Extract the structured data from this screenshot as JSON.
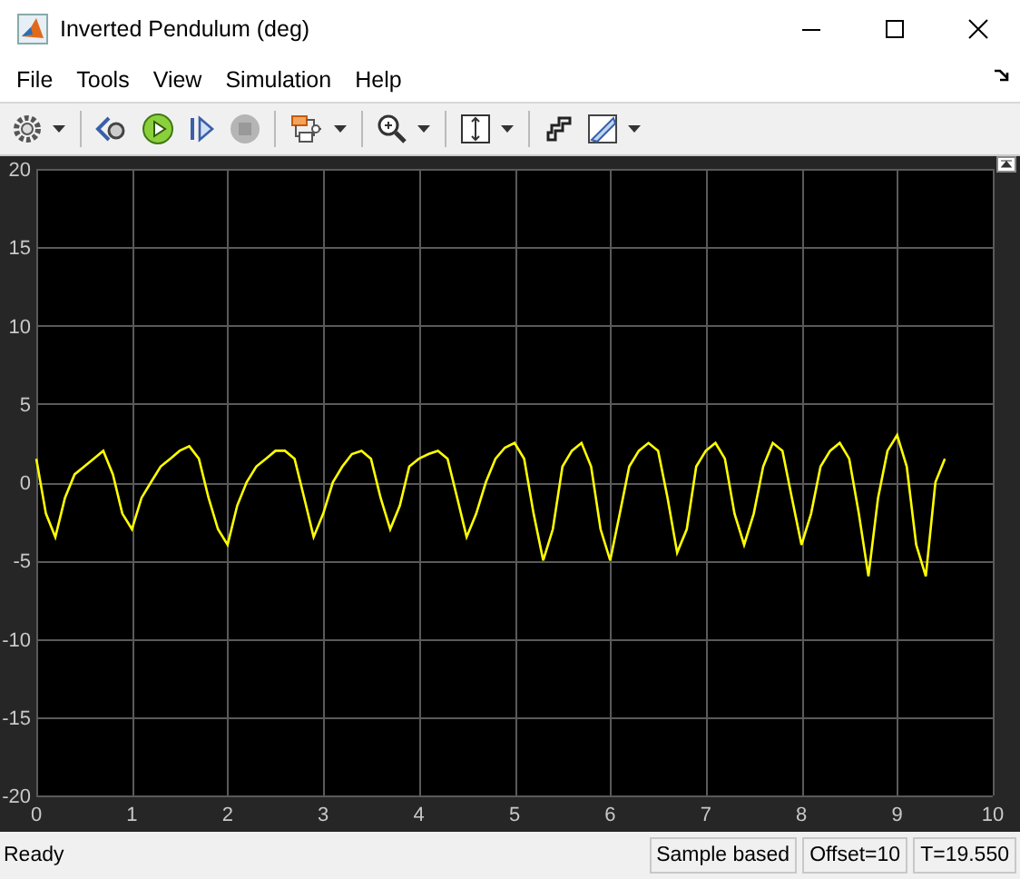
{
  "window": {
    "title": "Inverted Pendulum (deg)"
  },
  "menu": [
    "File",
    "Tools",
    "View",
    "Simulation",
    "Help"
  ],
  "scope": {
    "chart_data": {
      "type": "line",
      "grid": true,
      "xlim": [
        0,
        10
      ],
      "ylim": [
        -20,
        20
      ],
      "xticks": [
        0,
        1,
        2,
        3,
        4,
        5,
        6,
        7,
        8,
        9,
        10
      ],
      "yticks": [
        -20,
        -15,
        -10,
        -5,
        0,
        5,
        10,
        15,
        20
      ],
      "x": [
        0,
        0.1,
        0.2,
        0.3,
        0.4,
        0.5,
        0.6,
        0.7,
        0.8,
        0.9,
        1,
        1.1,
        1.2,
        1.3,
        1.4,
        1.5,
        1.6,
        1.7,
        1.8,
        1.9,
        2,
        2.1,
        2.2,
        2.3,
        2.4,
        2.5,
        2.6,
        2.7,
        2.8,
        2.9,
        3,
        3.1,
        3.2,
        3.3,
        3.4,
        3.5,
        3.6,
        3.7,
        3.8,
        3.9,
        4,
        4.1,
        4.2,
        4.3,
        4.4,
        4.5,
        4.6,
        4.7,
        4.8,
        4.9,
        5,
        5.1,
        5.2,
        5.3,
        5.4,
        5.5,
        5.6,
        5.7,
        5.8,
        5.9,
        6,
        6.1,
        6.2,
        6.3,
        6.4,
        6.5,
        6.6,
        6.7,
        6.8,
        6.9,
        7,
        7.1,
        7.2,
        7.3,
        7.4,
        7.5,
        7.6,
        7.7,
        7.8,
        7.9,
        8,
        8.1,
        8.2,
        8.3,
        8.4,
        8.5,
        8.6,
        8.7,
        8.8,
        8.9,
        9,
        9.1,
        9.2,
        9.3,
        9.4,
        9.5
      ],
      "series": [
        {
          "color": "#ffff00",
          "values": [
            1.5,
            -2,
            -3.5,
            -1,
            0.5,
            1,
            1.5,
            2,
            0.5,
            -2,
            -3,
            -1,
            0,
            1,
            1.5,
            2,
            2.3,
            1.5,
            -1,
            -3,
            -4,
            -1.5,
            0,
            1,
            1.5,
            2,
            2,
            1.5,
            -1,
            -3.5,
            -2,
            0,
            1,
            1.8,
            2,
            1.5,
            -1,
            -3,
            -1.5,
            1,
            1.5,
            1.8,
            2,
            1.5,
            -1,
            -3.5,
            -2,
            0,
            1.5,
            2.2,
            2.5,
            1.5,
            -2,
            -5,
            -3,
            1,
            2,
            2.5,
            1,
            -3,
            -5,
            -2,
            1,
            2,
            2.5,
            2,
            -1,
            -4.5,
            -3,
            1,
            2,
            2.5,
            1.5,
            -2,
            -4,
            -2,
            1,
            2.5,
            2,
            -1,
            -4,
            -2,
            1,
            2,
            2.5,
            1.5,
            -2,
            -6,
            -1,
            2,
            3,
            1,
            -4,
            -6,
            0,
            1.5
          ]
        }
      ]
    }
  },
  "status_bar": {
    "message": "Ready",
    "fields": [
      "Sample based",
      "Offset=10",
      "T=19.550"
    ]
  }
}
